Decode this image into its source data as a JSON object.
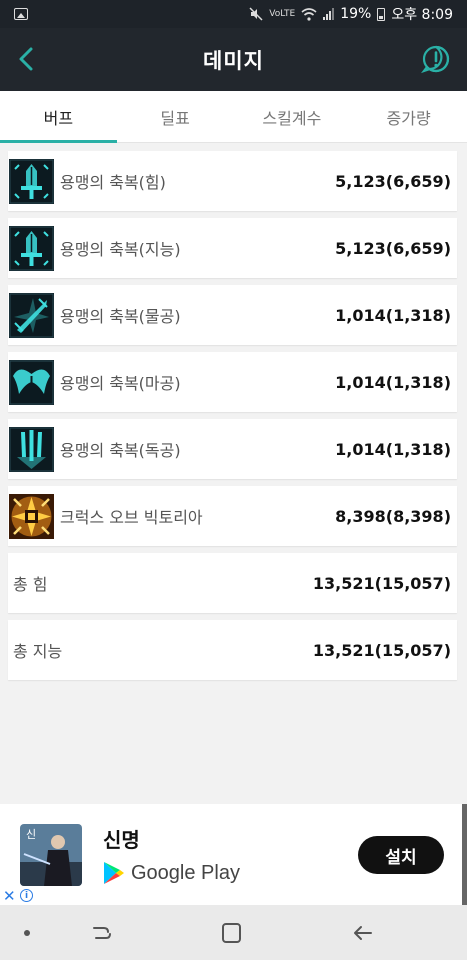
{
  "status_bar": {
    "volte": "VoLTE",
    "battery": "19%",
    "time": "오후 8:09"
  },
  "app_bar": {
    "title": "데미지",
    "back_icon": "back-arrow-icon",
    "info_icon": "alert-circle-icon"
  },
  "tabs": [
    {
      "label": "버프",
      "active": true
    },
    {
      "label": "딜표",
      "active": false
    },
    {
      "label": "스킬계수",
      "active": false
    },
    {
      "label": "증가량",
      "active": false
    }
  ],
  "buffs": [
    {
      "name": "용맹의 축복(힘)",
      "value": "5,123(6,659)",
      "icon": "sword-icon"
    },
    {
      "name": "용맹의 축복(지능)",
      "value": "5,123(6,659)",
      "icon": "sword-icon"
    },
    {
      "name": "용맹의 축복(물공)",
      "value": "1,014(1,318)",
      "icon": "crossed-blade-icon"
    },
    {
      "name": "용맹의 축복(마공)",
      "value": "1,014(1,318)",
      "icon": "wings-icon"
    },
    {
      "name": "용맹의 축복(독공)",
      "value": "1,014(1,318)",
      "icon": "claw-icon"
    },
    {
      "name": "크럭스 오브 빅토리아",
      "value": "8,398(8,398)",
      "icon": "cross-emblem-icon"
    }
  ],
  "totals": [
    {
      "name": "총 힘",
      "value": "13,521(15,057)"
    },
    {
      "name": "총 지능",
      "value": "13,521(15,057)"
    }
  ],
  "ad": {
    "app_name": "신명",
    "store": "Google Play",
    "install_label": "설치",
    "close_symbol": "✕",
    "info_symbol": "i"
  },
  "colors": {
    "accent": "#2ab0a6",
    "app_bar": "#22272d",
    "icon_glow": "#3fe0e0"
  }
}
